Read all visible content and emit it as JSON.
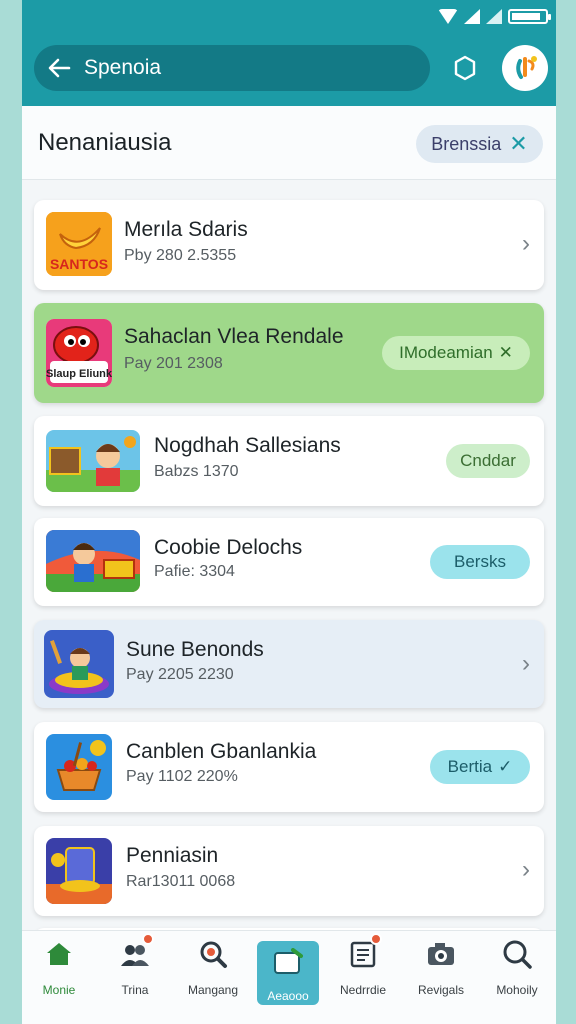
{
  "search": {
    "text": "Spenoia"
  },
  "header": {
    "title": "Nenaniausia",
    "filter_chip": "Brenssia"
  },
  "cards": [
    {
      "title": "Merıla Sdaris",
      "sub": "Pby 280 2.5355",
      "action": "chevron"
    },
    {
      "title": "Sahaclan Vlea Rendale",
      "sub": "Pay 201 2308",
      "action_label": "IModeamian"
    },
    {
      "title": "Nogdhah Sallesians",
      "sub": "Babzs 1370",
      "action_label": "Cnddar"
    },
    {
      "title": "Coobie Delochs",
      "sub": "Pafie: 3304",
      "action_label": "Bersks"
    },
    {
      "title": "Sune Benonds",
      "sub": "Pay 2205 2230",
      "action": "chevron"
    },
    {
      "title": "Canblen Gbanlankia",
      "sub": "Pay 1102 220%",
      "action_label": "Bertia"
    },
    {
      "title": "Penniasin",
      "sub": "Rar13011 0068",
      "action": "chevron"
    }
  ],
  "thumb_texts": {
    "card1": "SANTOS",
    "card2": "Slaup Eliunk"
  },
  "nav": [
    {
      "label": "Monie",
      "icon": "home-icon"
    },
    {
      "label": "Trina",
      "icon": "users-icon"
    },
    {
      "label": "Mangang",
      "icon": "search-icon"
    },
    {
      "label": "Aeaooo",
      "icon": "tablet-icon"
    },
    {
      "label": "Nedrrdie",
      "icon": "document-icon"
    },
    {
      "label": "Revigals",
      "icon": "camera-icon"
    },
    {
      "label": "Mohoily",
      "icon": "magnifier-icon"
    }
  ],
  "colors": {
    "primary": "#1c9ba6",
    "highlight_card": "#9fd88a",
    "active_nav": "#2e8a3a"
  }
}
